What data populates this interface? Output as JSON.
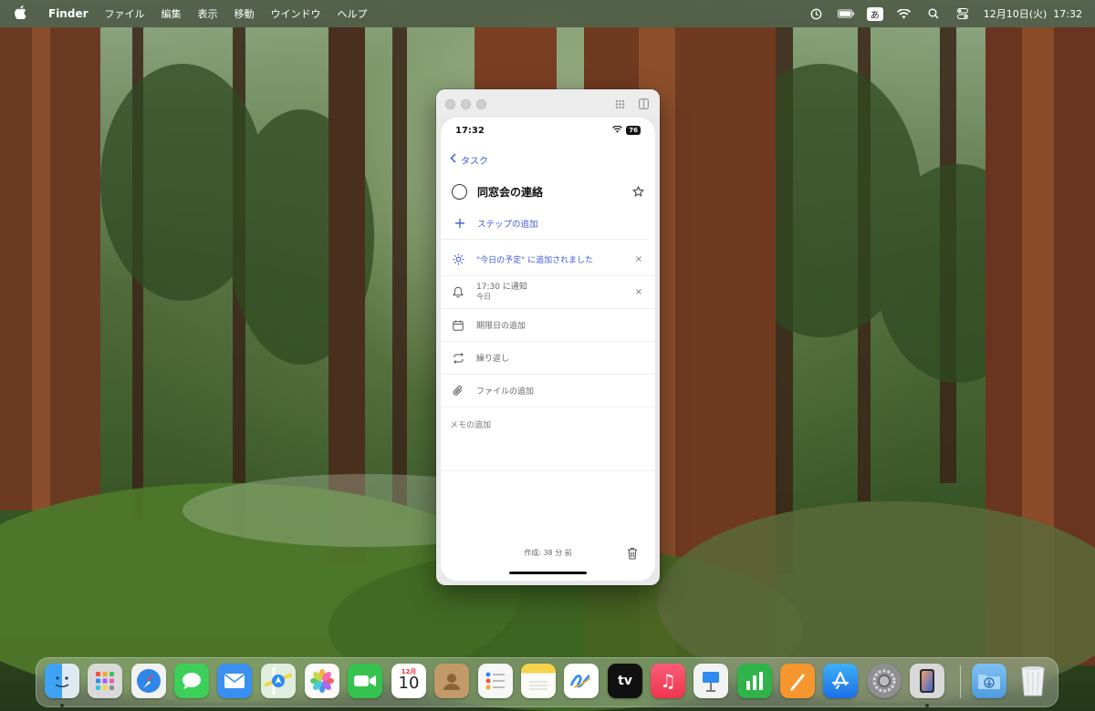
{
  "menubar": {
    "apple_icon": "apple-logo",
    "app_name": "Finder",
    "items": [
      "ファイル",
      "編集",
      "表示",
      "移動",
      "ウインドウ",
      "ヘルプ"
    ],
    "ime_label": "あ",
    "datetime": "12月10日(火)  17:32"
  },
  "window": {
    "statusbar": {
      "time": "17:32",
      "battery": "76"
    },
    "back_label": "タスク",
    "task_title": "同窓会の連絡",
    "add_step": "ステップの追加",
    "my_day": "\"今日の予定\" に追加されました",
    "reminder": {
      "label": "17:30 に通知",
      "sub": "今日"
    },
    "due_date": "期限日の追加",
    "repeat": "繰り返し",
    "attach_file": "ファイルの追加",
    "memo_placeholder": "メモの追加",
    "created": "作成: 38 分 前"
  },
  "dock": {
    "items": [
      {
        "name": "finder",
        "label": "",
        "color": "#3a8ee6"
      },
      {
        "name": "launchpad",
        "label": "",
        "color": "#d7d7d7"
      },
      {
        "name": "safari",
        "label": "",
        "color": "#2f7be0"
      },
      {
        "name": "messages",
        "label": "",
        "color": "#3ccf5a"
      },
      {
        "name": "mail",
        "label": "",
        "color": "#3a8ff0"
      },
      {
        "name": "maps",
        "label": "",
        "color": "#5fbf6a"
      },
      {
        "name": "photos",
        "label": "",
        "color": "#f2f2f2"
      },
      {
        "name": "facetime",
        "label": "",
        "color": "#36c24f"
      },
      {
        "name": "calendar",
        "label": "10",
        "month": "12月",
        "color": "#ffffff"
      },
      {
        "name": "contacts",
        "label": "",
        "color": "#b38a5c"
      },
      {
        "name": "reminders",
        "label": "",
        "color": "#f7f7f7"
      },
      {
        "name": "notes",
        "label": "",
        "color": "#f5d34a"
      },
      {
        "name": "freeform",
        "label": "",
        "color": "#ffffff"
      },
      {
        "name": "tv",
        "label": "tv",
        "color": "#111111"
      },
      {
        "name": "music",
        "label": "♫",
        "color": "#f5405d"
      },
      {
        "name": "keynote",
        "label": "",
        "color": "#2f7be0"
      },
      {
        "name": "numbers",
        "label": "",
        "color": "#30b34a"
      },
      {
        "name": "pages",
        "label": "",
        "color": "#f5962f"
      },
      {
        "name": "app-store",
        "label": "A",
        "color": "#2e8cf0"
      },
      {
        "name": "system-settings",
        "label": "⚙",
        "color": "#8e8e93"
      },
      {
        "name": "iphone-mirroring",
        "label": "",
        "color": "#3b3b3d"
      },
      {
        "name": "downloads",
        "label": "⬇",
        "color": "#5aa7e8"
      },
      {
        "name": "trash",
        "label": "",
        "color": "#eef0f2"
      }
    ]
  }
}
